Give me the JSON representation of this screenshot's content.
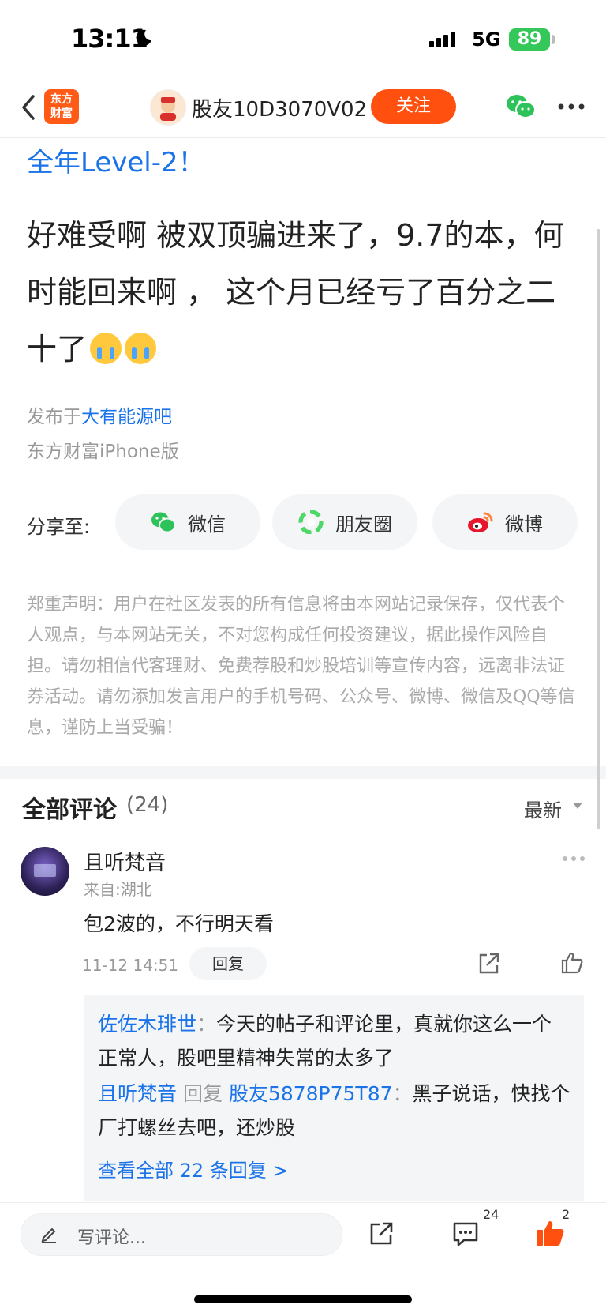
{
  "status_bar": {
    "time": "13:11",
    "network": "5G",
    "battery": "89"
  },
  "nav": {
    "logo_line1": "东方",
    "logo_line2": "财富",
    "username": "股友10D3070V02",
    "follow_label": "关注"
  },
  "post": {
    "banner_link": "全年Level-2！",
    "text": "好难受啊 被双顶骗进来了，9.7的本，何时能回来啊 ， 这个月已经亏了百分之二十了",
    "published_prefix": "发布于",
    "forum": "大有能源吧",
    "client": "东方财富iPhone版"
  },
  "share": {
    "label": "分享至:",
    "wechat": "微信",
    "moments": "朋友圈",
    "weibo": "微博"
  },
  "disclaimer": "郑重声明：用户在社区发表的所有信息将由本网站记录保存，仅代表个人观点，与本网站无关，不对您构成任何投资建议，据此操作风险自担。请勿相信代客理财、免费荐股和炒股培训等宣传内容，远离非法证券活动。请勿添加发言用户的手机号码、公众号、微博、微信及QQ等信息，谨防上当受骗！",
  "comments": {
    "title": "全部评论",
    "count": "(24)",
    "sort": "最新",
    "items": [
      {
        "name": "且听梵音",
        "location": "来自:湖北",
        "text": "包2波的，不行明天看",
        "time": "11-12 14:51",
        "reply_label": "回复",
        "replies": [
          {
            "author": "佐佐木琲世",
            "sep": "：",
            "text": "今天的帖子和评论里，真就你这么一个正常人，股吧里精神失常的太多了"
          },
          {
            "author": "且听梵音",
            "reply_word": " 回复 ",
            "target": "股友5878P75T87",
            "sep": "：",
            "text": "黑子说话，快找个厂打螺丝去吧，还炒股"
          }
        ],
        "view_all": "查看全部 22 条回复 >"
      }
    ]
  },
  "bottom_bar": {
    "placeholder": "写评论...",
    "comment_count": "24",
    "like_count": "2"
  },
  "colors": {
    "accent": "#ff5010",
    "link": "#1a73e8",
    "battery": "#34c759"
  }
}
